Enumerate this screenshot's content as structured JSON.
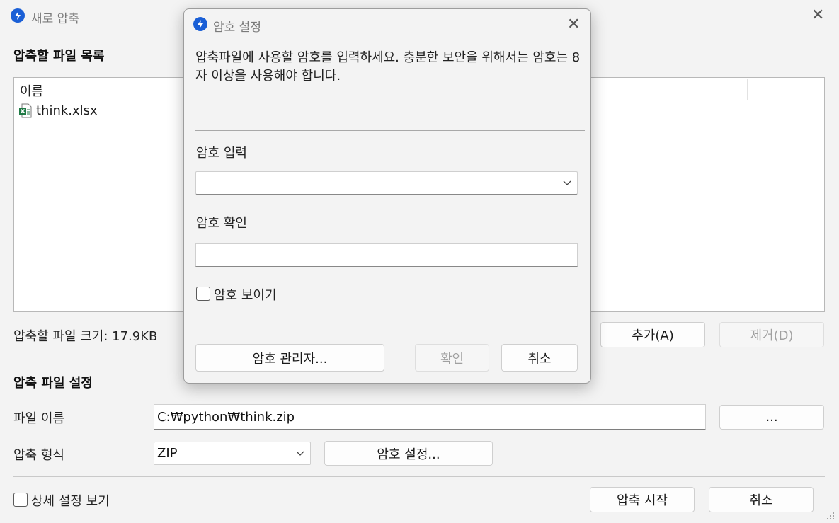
{
  "main": {
    "title": "새로 압축",
    "file_list_section": "압축할 파일 목록",
    "column_name": "이름",
    "files": [
      {
        "name": "think.xlsx",
        "icon": "excel-icon"
      }
    ],
    "size_label": "압축할 파일 크기: 17.9KB",
    "add_button": "추가(A)",
    "remove_button": "제거(D)",
    "settings_section": "압축 파일 설정",
    "filename_label": "파일 이름",
    "filename_value": "C:₩python₩think.zip",
    "browse_button": "...",
    "format_label": "압축 형식",
    "format_value": "ZIP",
    "password_button": "암호 설정...",
    "advanced_checkbox_label": "상세 설정 보기",
    "start_button": "압축 시작",
    "cancel_button": "취소"
  },
  "dialog": {
    "title": "암호 설정",
    "description": "압축파일에 사용할 암호를 입력하세요. 충분한 보안을 위해서는 암호는 8자 이상을 사용해야 합니다.",
    "password_label": "암호 입력",
    "password_value": "",
    "confirm_label": "암호 확인",
    "confirm_value": "",
    "show_password_label": "암호 보이기",
    "manager_button": "암호 관리자...",
    "ok_button": "확인",
    "cancel_button": "취소"
  },
  "colors": {
    "accent": "#1a5fd6",
    "excel_green": "#1f7a45",
    "disabled_text": "#a0a0a0"
  }
}
